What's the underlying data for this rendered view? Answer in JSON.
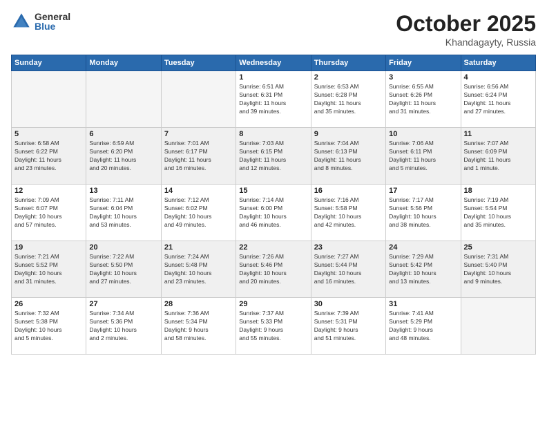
{
  "logo": {
    "general": "General",
    "blue": "Blue"
  },
  "header": {
    "month": "October 2025",
    "location": "Khandagayty, Russia"
  },
  "weekdays": [
    "Sunday",
    "Monday",
    "Tuesday",
    "Wednesday",
    "Thursday",
    "Friday",
    "Saturday"
  ],
  "weeks": [
    [
      {
        "day": "",
        "info": ""
      },
      {
        "day": "",
        "info": ""
      },
      {
        "day": "",
        "info": ""
      },
      {
        "day": "1",
        "info": "Sunrise: 6:51 AM\nSunset: 6:31 PM\nDaylight: 11 hours\nand 39 minutes."
      },
      {
        "day": "2",
        "info": "Sunrise: 6:53 AM\nSunset: 6:28 PM\nDaylight: 11 hours\nand 35 minutes."
      },
      {
        "day": "3",
        "info": "Sunrise: 6:55 AM\nSunset: 6:26 PM\nDaylight: 11 hours\nand 31 minutes."
      },
      {
        "day": "4",
        "info": "Sunrise: 6:56 AM\nSunset: 6:24 PM\nDaylight: 11 hours\nand 27 minutes."
      }
    ],
    [
      {
        "day": "5",
        "info": "Sunrise: 6:58 AM\nSunset: 6:22 PM\nDaylight: 11 hours\nand 23 minutes."
      },
      {
        "day": "6",
        "info": "Sunrise: 6:59 AM\nSunset: 6:20 PM\nDaylight: 11 hours\nand 20 minutes."
      },
      {
        "day": "7",
        "info": "Sunrise: 7:01 AM\nSunset: 6:17 PM\nDaylight: 11 hours\nand 16 minutes."
      },
      {
        "day": "8",
        "info": "Sunrise: 7:03 AM\nSunset: 6:15 PM\nDaylight: 11 hours\nand 12 minutes."
      },
      {
        "day": "9",
        "info": "Sunrise: 7:04 AM\nSunset: 6:13 PM\nDaylight: 11 hours\nand 8 minutes."
      },
      {
        "day": "10",
        "info": "Sunrise: 7:06 AM\nSunset: 6:11 PM\nDaylight: 11 hours\nand 5 minutes."
      },
      {
        "day": "11",
        "info": "Sunrise: 7:07 AM\nSunset: 6:09 PM\nDaylight: 11 hours\nand 1 minute."
      }
    ],
    [
      {
        "day": "12",
        "info": "Sunrise: 7:09 AM\nSunset: 6:07 PM\nDaylight: 10 hours\nand 57 minutes."
      },
      {
        "day": "13",
        "info": "Sunrise: 7:11 AM\nSunset: 6:04 PM\nDaylight: 10 hours\nand 53 minutes."
      },
      {
        "day": "14",
        "info": "Sunrise: 7:12 AM\nSunset: 6:02 PM\nDaylight: 10 hours\nand 49 minutes."
      },
      {
        "day": "15",
        "info": "Sunrise: 7:14 AM\nSunset: 6:00 PM\nDaylight: 10 hours\nand 46 minutes."
      },
      {
        "day": "16",
        "info": "Sunrise: 7:16 AM\nSunset: 5:58 PM\nDaylight: 10 hours\nand 42 minutes."
      },
      {
        "day": "17",
        "info": "Sunrise: 7:17 AM\nSunset: 5:56 PM\nDaylight: 10 hours\nand 38 minutes."
      },
      {
        "day": "18",
        "info": "Sunrise: 7:19 AM\nSunset: 5:54 PM\nDaylight: 10 hours\nand 35 minutes."
      }
    ],
    [
      {
        "day": "19",
        "info": "Sunrise: 7:21 AM\nSunset: 5:52 PM\nDaylight: 10 hours\nand 31 minutes."
      },
      {
        "day": "20",
        "info": "Sunrise: 7:22 AM\nSunset: 5:50 PM\nDaylight: 10 hours\nand 27 minutes."
      },
      {
        "day": "21",
        "info": "Sunrise: 7:24 AM\nSunset: 5:48 PM\nDaylight: 10 hours\nand 23 minutes."
      },
      {
        "day": "22",
        "info": "Sunrise: 7:26 AM\nSunset: 5:46 PM\nDaylight: 10 hours\nand 20 minutes."
      },
      {
        "day": "23",
        "info": "Sunrise: 7:27 AM\nSunset: 5:44 PM\nDaylight: 10 hours\nand 16 minutes."
      },
      {
        "day": "24",
        "info": "Sunrise: 7:29 AM\nSunset: 5:42 PM\nDaylight: 10 hours\nand 13 minutes."
      },
      {
        "day": "25",
        "info": "Sunrise: 7:31 AM\nSunset: 5:40 PM\nDaylight: 10 hours\nand 9 minutes."
      }
    ],
    [
      {
        "day": "26",
        "info": "Sunrise: 7:32 AM\nSunset: 5:38 PM\nDaylight: 10 hours\nand 5 minutes."
      },
      {
        "day": "27",
        "info": "Sunrise: 7:34 AM\nSunset: 5:36 PM\nDaylight: 10 hours\nand 2 minutes."
      },
      {
        "day": "28",
        "info": "Sunrise: 7:36 AM\nSunset: 5:34 PM\nDaylight: 9 hours\nand 58 minutes."
      },
      {
        "day": "29",
        "info": "Sunrise: 7:37 AM\nSunset: 5:33 PM\nDaylight: 9 hours\nand 55 minutes."
      },
      {
        "day": "30",
        "info": "Sunrise: 7:39 AM\nSunset: 5:31 PM\nDaylight: 9 hours\nand 51 minutes."
      },
      {
        "day": "31",
        "info": "Sunrise: 7:41 AM\nSunset: 5:29 PM\nDaylight: 9 hours\nand 48 minutes."
      },
      {
        "day": "",
        "info": ""
      }
    ]
  ]
}
